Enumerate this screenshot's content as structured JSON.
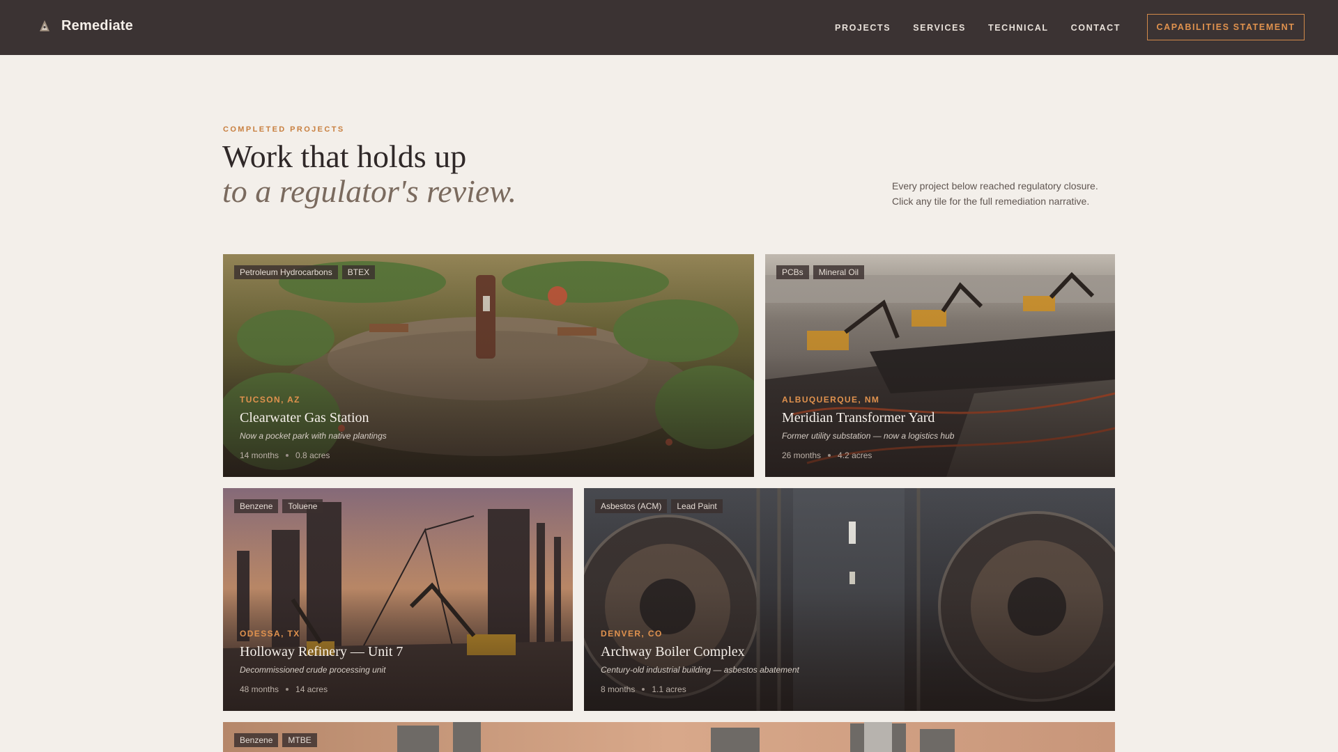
{
  "nav": {
    "brand": "Remediate",
    "links": [
      "PROJECTS",
      "SERVICES",
      "TECHNICAL",
      "CONTACT"
    ],
    "cta": "CAPABILITIES STATEMENT"
  },
  "hero": {
    "eyebrow": "COMPLETED PROJECTS",
    "title_line1": "Work that holds up",
    "title_line2": "to a regulator's review.",
    "intro_line1": "Every project below reached regulatory closure.",
    "intro_line2": "Click any tile for the full remediation narrative."
  },
  "projects": [
    {
      "tags": [
        "Petroleum Hydrocarbons",
        "BTEX"
      ],
      "location": "TUCSON, AZ",
      "title": "Clearwater Gas Station",
      "subtitle": "Now a pocket park with native plantings",
      "duration": "14 months",
      "area": "0.8 acres"
    },
    {
      "tags": [
        "PCBs",
        "Mineral Oil"
      ],
      "location": "ALBUQUERQUE, NM",
      "title": "Meridian Transformer Yard",
      "subtitle": "Former utility substation — now a logistics hub",
      "duration": "26 months",
      "area": "4.2 acres"
    },
    {
      "tags": [
        "Benzene",
        "Toluene"
      ],
      "location": "ODESSA, TX",
      "title": "Holloway Refinery — Unit 7",
      "subtitle": "Decommissioned crude processing unit",
      "duration": "48 months",
      "area": "14 acres"
    },
    {
      "tags": [
        "Asbestos (ACM)",
        "Lead Paint"
      ],
      "location": "DENVER, CO",
      "title": "Archway Boiler Complex",
      "subtitle": "Century-old industrial building — asbestos abatement",
      "duration": "8 months",
      "area": "1.1 acres"
    },
    {
      "tags": [
        "Benzene",
        "MTBE"
      ]
    }
  ],
  "colors": {
    "nav_bg": "#3b3333",
    "page_bg": "#f3efea",
    "accent": "#e0924e"
  }
}
